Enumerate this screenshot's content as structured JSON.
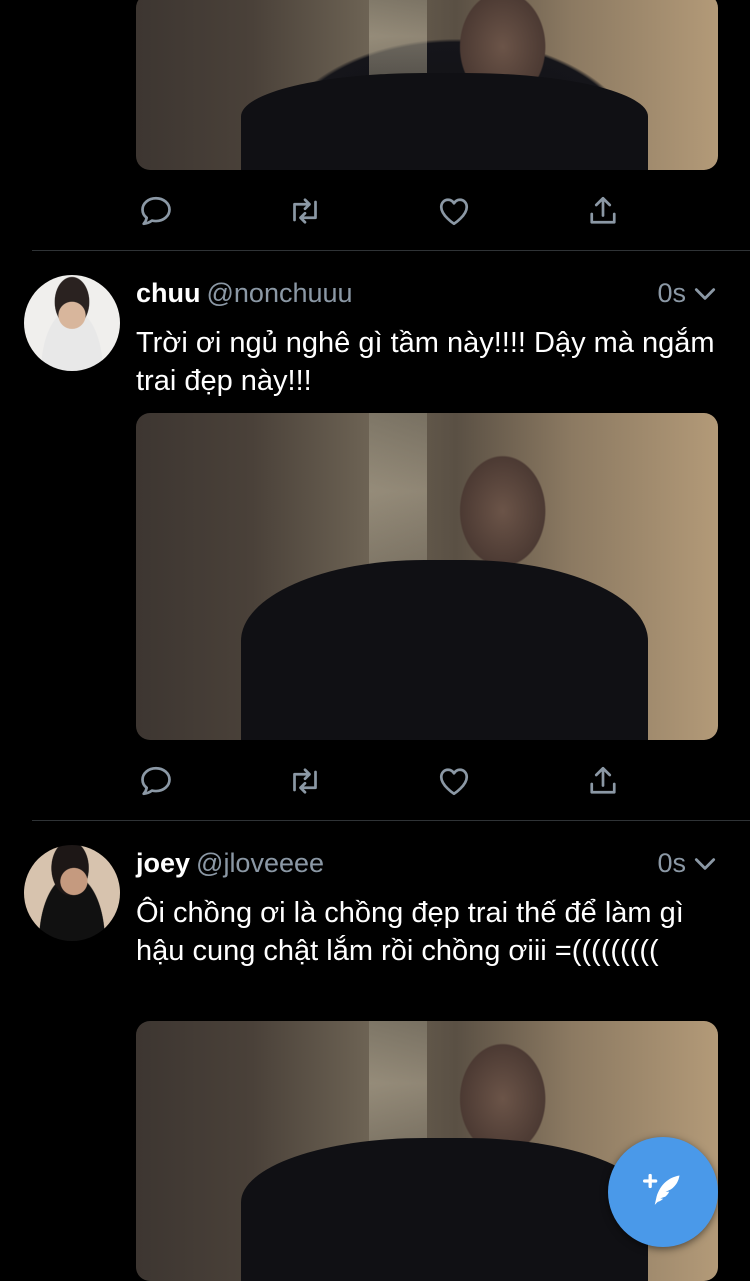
{
  "colors": {
    "background": "#000000",
    "text_primary": "#ffffff",
    "text_secondary": "#8b98a5",
    "divider": "#2f3336",
    "accent": "#4a99e9"
  },
  "tweets": [
    {
      "display_name": "chuu",
      "handle": "@nonchuuu",
      "time": "0s",
      "text": "Trời ơi ngủ nghê gì tầm này!!!! Dậy mà ngắm trai đẹp này!!!"
    },
    {
      "display_name": "joey",
      "handle": "@jloveeee",
      "time": "0s",
      "text": "Ôi chồng ơi là chồng đẹp trai thế để làm gì hậu cung chật lắm rồi chồng ơiii =((((((((("
    }
  ],
  "icons": {
    "reply": "reply-icon",
    "retweet": "retweet-icon",
    "like": "like-icon",
    "share": "share-icon",
    "more": "chevron-down-icon",
    "compose": "compose-icon"
  }
}
